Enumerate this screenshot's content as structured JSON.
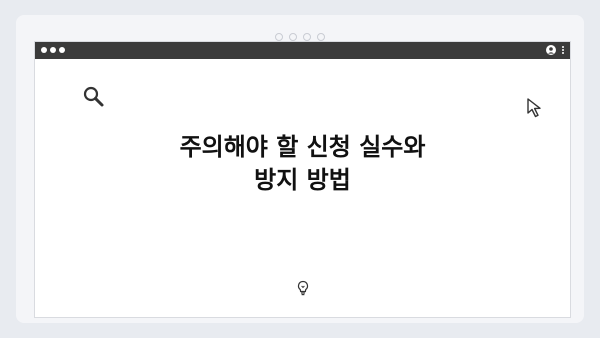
{
  "window": {
    "title_dots": 4
  },
  "page": {
    "headline_line1": "주의해야 할 신청 실수와",
    "headline_line2": "방지 방법"
  },
  "icons": {
    "search": "search-icon",
    "cursor": "cursor-icon",
    "bulb": "lightbulb-icon",
    "account": "account-icon",
    "menu": "kebab-menu-icon"
  },
  "colors": {
    "titlebar": "#3b3b3b",
    "headline": "#111111",
    "background": "#e8ebf0"
  }
}
